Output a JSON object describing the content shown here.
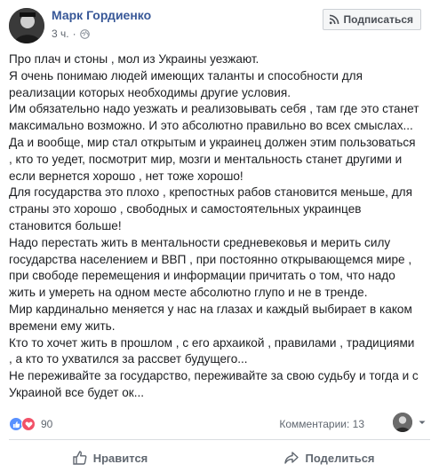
{
  "header": {
    "author": "Марк Гордиенко",
    "time": "3 ч.",
    "subscribe_label": "Подписаться"
  },
  "post": {
    "paragraphs": [
      "Про плач и стоны , мол из Украины уезжают.",
      "Я очень понимаю людей имеющих таланты и способности для\nреализации которых необходимы другие условия.",
      "Им обязательно надо уезжать и реализовывать себя , там где это станет\nмаксимально возможно. И это абсолютно правильно во всех смыслах...",
      "Да и вообще, мир стал открытым и украинец должен этим пользоваться\n, кто то уедет, посмотрит мир, мозги и ментальность станет другими и\nесли вернется хорошо , нет тоже хорошо!",
      "Для государства это плохо , крепостных рабов становится меньше, для\nстраны это хорошо , свободных и самостоятельных украинцев\nстановится больше!",
      "Надо перестать жить в ментальности средневековья и мерить силу\nгосударства населением и ВВП , при постоянно открывающемся мире ,\nпри свободе перемещения и информации причитать о том, что надо\nжить и умереть на одном месте абсолютно глупо и не в тренде.",
      "Мир кардинально меняется у нас на глазах и каждый выбирает в каком\nвремени ему жить.",
      "Кто то хочет жить в прошлом , с его архаикой , правилами , традициями\n, а кто то ухватился за рассвет будущего...",
      "Не переживайте за государство, переживайте за свою судьбу и тогда и с\nУкраиной все будет ок..."
    ]
  },
  "footer": {
    "reaction_count": "90",
    "comments": "Комментарии: 13",
    "like_label": "Нравится",
    "share_label": "Поделиться"
  },
  "colors": {
    "author": "#385898",
    "like_reaction": "#5890ff",
    "love_reaction": "#f25268",
    "muted_text": "#606770"
  },
  "icons": [
    "globe-icon",
    "rss-icon",
    "like-reaction-icon",
    "love-reaction-icon",
    "thumbs-up-icon",
    "share-arrow-icon",
    "caret-down-icon"
  ]
}
